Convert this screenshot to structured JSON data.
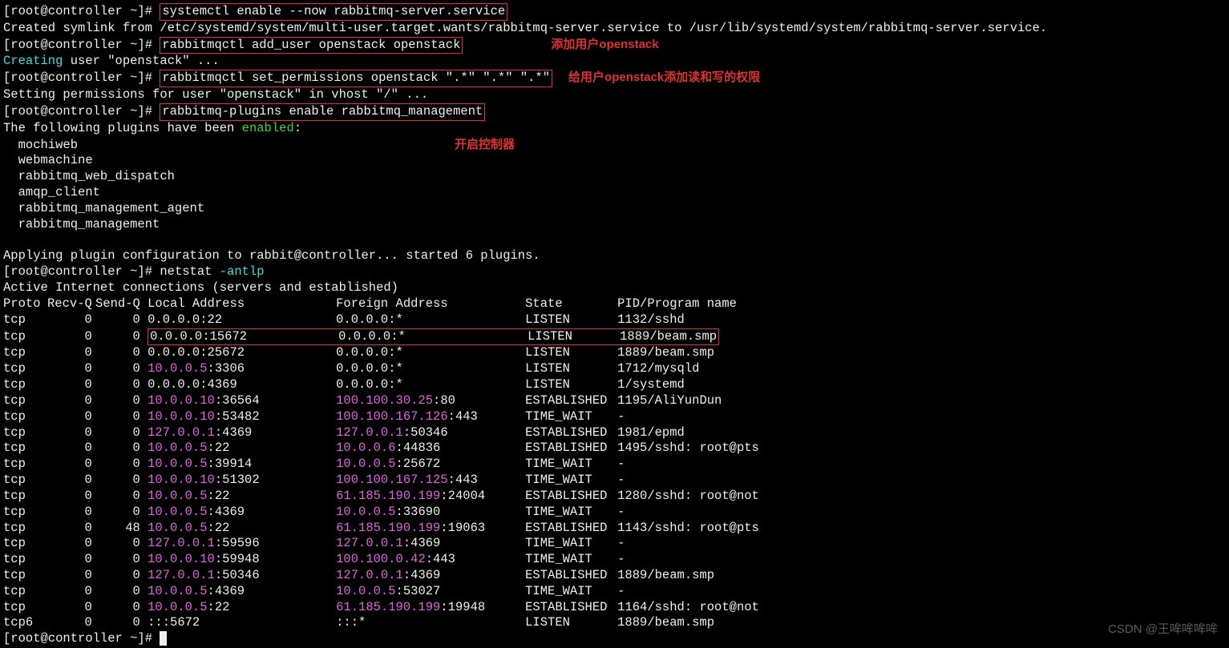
{
  "prompt": "[root@controller ~]# ",
  "cmd1": "systemctl enable --now rabbitmq-server.service",
  "out1": "Created symlink from /etc/systemd/system/multi-user.target.wants/rabbitmq-server.service to /usr/lib/systemd/system/rabbitmq-server.service.",
  "cmd2": "rabbitmqctl add_user openstack openstack",
  "annot2": "添加用户openstack",
  "out2a": "Creating",
  "out2b": " user \"openstack\" ...",
  "cmd3": "rabbitmqctl set_permissions openstack \".*\" \".*\" \".*\"",
  "annot3": "给用户openstack添加读和写的权限",
  "out3": "Setting permissions for user \"openstack\" in vhost \"/\" ...",
  "cmd4": "rabbitmq-plugins enable rabbitmq_management",
  "out4a": "The following plugins have been ",
  "out4b": "enabled",
  "out4c": ":",
  "annot4": "开启控制器",
  "plugins": [
    "  mochiweb",
    "  webmachine",
    "  rabbitmq_web_dispatch",
    "  amqp_client",
    "  rabbitmq_management_agent",
    "  rabbitmq_management"
  ],
  "apply": "Applying plugin configuration to rabbit@controller... started 6 plugins.",
  "cmd5a": "netstat ",
  "cmd5b": "-antlp",
  "nethdr": "Active Internet connections (servers and established)",
  "cols": {
    "proto": "Proto",
    "recvq": "Recv-Q",
    "sendq": "Send-Q",
    "local": "Local Address",
    "foreign": "Foreign Address",
    "state": "State",
    "pid": "PID/Program name"
  },
  "rows": [
    {
      "proto": "tcp",
      "r": "0",
      "s": "0",
      "la": "0.0.0.0",
      "lp": ":22",
      "fa": "0.0.0.0",
      "fp": ":*",
      "st": "LISTEN",
      "pid": "1132/sshd",
      "box": false
    },
    {
      "proto": "tcp",
      "r": "0",
      "s": "0",
      "la": "0.0.0.0",
      "lp": ":15672",
      "fa": "0.0.0.0",
      "fp": ":*",
      "st": "LISTEN",
      "pid": "1889/beam.smp",
      "box": true
    },
    {
      "proto": "tcp",
      "r": "0",
      "s": "0",
      "la": "0.0.0.0",
      "lp": ":25672",
      "fa": "0.0.0.0",
      "fp": ":*",
      "st": "LISTEN",
      "pid": "1889/beam.smp",
      "box": false
    },
    {
      "proto": "tcp",
      "r": "0",
      "s": "0",
      "la": "10.0.0.5",
      "lp": ":3306",
      "fa": "0.0.0.0",
      "fp": ":*",
      "st": "LISTEN",
      "pid": "1712/mysqld",
      "box": false,
      "lmag": true
    },
    {
      "proto": "tcp",
      "r": "0",
      "s": "0",
      "la": "0.0.0.0",
      "lp": ":4369",
      "fa": "0.0.0.0",
      "fp": ":*",
      "st": "LISTEN",
      "pid": "1/systemd",
      "box": false
    },
    {
      "proto": "tcp",
      "r": "0",
      "s": "0",
      "la": "10.0.0.10",
      "lp": ":36564",
      "fa": "100.100.30.25",
      "fp": ":80",
      "st": "ESTABLISHED",
      "pid": "1195/AliYunDun",
      "lmag": true,
      "fmag": true
    },
    {
      "proto": "tcp",
      "r": "0",
      "s": "0",
      "la": "10.0.0.10",
      "lp": ":53482",
      "fa": "100.100.167.126",
      "fp": ":443",
      "st": "TIME_WAIT",
      "pid": "-",
      "lmag": true,
      "fmag": true
    },
    {
      "proto": "tcp",
      "r": "0",
      "s": "0",
      "la": "127.0.0.1",
      "lp": ":4369",
      "fa": "127.0.0.1",
      "fp": ":50346",
      "st": "ESTABLISHED",
      "pid": "1981/epmd",
      "lmag": true,
      "fmag": true
    },
    {
      "proto": "tcp",
      "r": "0",
      "s": "0",
      "la": "10.0.0.5",
      "lp": ":22",
      "fa": "10.0.0.6",
      "fp": ":44836",
      "st": "ESTABLISHED",
      "pid": "1495/sshd: root@pts",
      "lmag": true,
      "fmag": true
    },
    {
      "proto": "tcp",
      "r": "0",
      "s": "0",
      "la": "10.0.0.5",
      "lp": ":39914",
      "fa": "10.0.0.5",
      "fp": ":25672",
      "st": "TIME_WAIT",
      "pid": "-",
      "lmag": true,
      "fmag": true
    },
    {
      "proto": "tcp",
      "r": "0",
      "s": "0",
      "la": "10.0.0.10",
      "lp": ":51302",
      "fa": "100.100.167.125",
      "fp": ":443",
      "st": "TIME_WAIT",
      "pid": "-",
      "lmag": true,
      "fmag": true
    },
    {
      "proto": "tcp",
      "r": "0",
      "s": "0",
      "la": "10.0.0.5",
      "lp": ":22",
      "fa": "61.185.190.199",
      "fp": ":24004",
      "st": "ESTABLISHED",
      "pid": "1280/sshd: root@not",
      "lmag": true,
      "fmag": true
    },
    {
      "proto": "tcp",
      "r": "0",
      "s": "0",
      "la": "10.0.0.5",
      "lp": ":4369",
      "fa": "10.0.0.5",
      "fp": ":33690",
      "st": "TIME_WAIT",
      "pid": "-",
      "lmag": true,
      "fmag": true
    },
    {
      "proto": "tcp",
      "r": "0",
      "s": "48",
      "la": "10.0.0.5",
      "lp": ":22",
      "fa": "61.185.190.199",
      "fp": ":19063",
      "st": "ESTABLISHED",
      "pid": "1143/sshd: root@pts",
      "lmag": true,
      "fmag": true
    },
    {
      "proto": "tcp",
      "r": "0",
      "s": "0",
      "la": "127.0.0.1",
      "lp": ":59596",
      "fa": "127.0.0.1",
      "fp": ":4369",
      "st": "TIME_WAIT",
      "pid": "-",
      "lmag": true,
      "fmag": true
    },
    {
      "proto": "tcp",
      "r": "0",
      "s": "0",
      "la": "10.0.0.10",
      "lp": ":59948",
      "fa": "100.100.0.42",
      "fp": ":443",
      "st": "TIME_WAIT",
      "pid": "-",
      "lmag": true,
      "fmag": true
    },
    {
      "proto": "tcp",
      "r": "0",
      "s": "0",
      "la": "127.0.0.1",
      "lp": ":50346",
      "fa": "127.0.0.1",
      "fp": ":4369",
      "st": "ESTABLISHED",
      "pid": "1889/beam.smp",
      "lmag": true,
      "fmag": true
    },
    {
      "proto": "tcp",
      "r": "0",
      "s": "0",
      "la": "10.0.0.5",
      "lp": ":4369",
      "fa": "10.0.0.5",
      "fp": ":53027",
      "st": "TIME_WAIT",
      "pid": "-",
      "lmag": true,
      "fmag": true
    },
    {
      "proto": "tcp",
      "r": "0",
      "s": "0",
      "la": "10.0.0.5",
      "lp": ":22",
      "fa": "61.185.190.199",
      "fp": ":19948",
      "st": "ESTABLISHED",
      "pid": "1164/sshd: root@not",
      "lmag": true,
      "fmag": true
    },
    {
      "proto": "tcp6",
      "r": "0",
      "s": "0",
      "la": ":::5672",
      "lp": "",
      "fa": ":::*",
      "fp": "",
      "st": "LISTEN",
      "pid": "1889/beam.smp"
    }
  ],
  "watermark": "CSDN @王哞哞哞哞"
}
